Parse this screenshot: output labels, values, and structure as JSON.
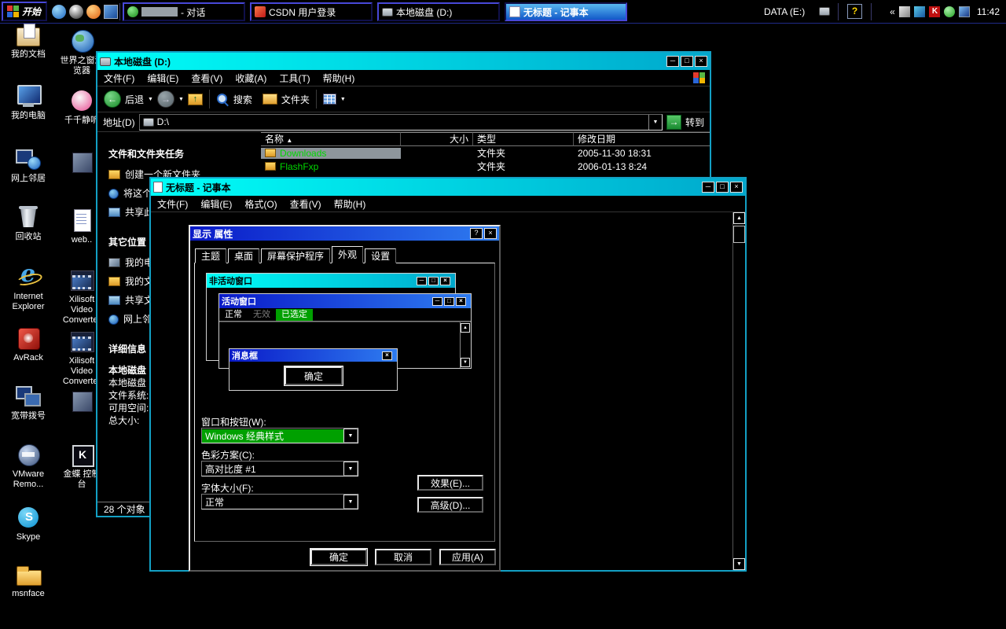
{
  "colors": {
    "active_title_start": "#0a1ac8",
    "active_title_end": "#2e7cf0",
    "inactive_title_start": "#00fff8",
    "inactive_title_end": "#00a8cc",
    "highlight_green": "#00a000",
    "filename_green": "#00d800",
    "desktop_background": "#000000"
  },
  "glyphs": {
    "minimize": "─",
    "maximize": "□",
    "close": "×",
    "help": "?",
    "dropdown": "▼",
    "up": "▲",
    "down": "▼",
    "back": "←",
    "forward": "→",
    "go": "→",
    "up_arrow": "↑",
    "sort": "▲",
    "chevron": "«"
  },
  "taskbar": {
    "start_label": "开始",
    "chat_button_suffix": "- 对话",
    "csdn_button": "CSDN 用户登录",
    "disk_button": "本地磁盘 (D:)",
    "notepad_button": "无标题 - 记事本",
    "drive_label": "DATA (E:)",
    "clock": "11:42"
  },
  "desktop": {
    "col1": [
      {
        "label": "我的文档"
      },
      {
        "label": "我的电脑"
      },
      {
        "label": "网上邻居"
      },
      {
        "label": "回收站"
      },
      {
        "label": "Internet Explorer"
      },
      {
        "label": "AvRack"
      },
      {
        "label": "宽带拨号"
      },
      {
        "label": "VMware Remo..."
      },
      {
        "label": "Skype"
      },
      {
        "label": "msnface"
      }
    ],
    "col2": [
      {
        "label": "世界之窗浏览器"
      },
      {
        "label": "千千静听"
      },
      {
        "label": ""
      },
      {
        "label": "web.."
      },
      {
        "label": "Xilisoft Video Converter"
      },
      {
        "label": "Xilisoft Video Converter"
      },
      {
        "label": ""
      },
      {
        "label": "金蝶 控制台"
      }
    ]
  },
  "explorer": {
    "title": "本地磁盘 (D:)",
    "menu": [
      "文件(F)",
      "编辑(E)",
      "查看(V)",
      "收藏(A)",
      "工具(T)",
      "帮助(H)"
    ],
    "toolbar": {
      "back": "后退",
      "search": "搜索",
      "folders": "文件夹"
    },
    "address_label": "地址(D)",
    "address_value": "D:\\",
    "go_label": "转到",
    "columns": {
      "name": "名称",
      "size": "大小",
      "type": "类型",
      "modified": "修改日期"
    },
    "rows": [
      {
        "name": "Downloads",
        "size": "",
        "type": "文件夹",
        "modified": "2005-11-30 18:31",
        "selected": true
      },
      {
        "name": "FlashFxp",
        "size": "",
        "type": "文件夹",
        "modified": "2006-01-13 8:24",
        "selected": false
      }
    ],
    "tasks_header": "文件和文件夹任务",
    "tasks": [
      "创建一个新文件夹",
      "将这个文件夹发布到 Web",
      "共享此文件夹"
    ],
    "other_header": "其它位置",
    "other_items": [
      "我的电脑",
      "我的文档",
      "共享文档",
      "网上邻居"
    ],
    "details_header": "详细信息",
    "details_title": "本地磁盘 (D:)",
    "details_lines": [
      "本地磁盘",
      "文件系统:",
      "可用空间:",
      "总大小:"
    ],
    "status": "28 个对象"
  },
  "notepad": {
    "title": "无标题 - 记事本",
    "menu": [
      "文件(F)",
      "编辑(E)",
      "格式(O)",
      "查看(V)",
      "帮助(H)"
    ]
  },
  "display_dialog": {
    "title": "显示 属性",
    "tabs": [
      "主题",
      "桌面",
      "屏幕保护程序",
      "外观",
      "设置"
    ],
    "active_tab": "外观",
    "preview": {
      "inactive_window_title": "非活动窗口",
      "active_window_title": "活动窗口",
      "menu_normal": "正常",
      "menu_disabled": "无效",
      "menu_selected": "已选定",
      "msgbox_title": "消息框",
      "msgbox_ok": "确定"
    },
    "window_buttons_label": "窗口和按钮(W):",
    "window_buttons_value": "Windows 经典样式",
    "color_scheme_label": "色彩方案(C):",
    "color_scheme_value": "高对比度 #1",
    "font_size_label": "字体大小(F):",
    "font_size_value": "正常",
    "effects_button": "效果(E)...",
    "advanced_button": "高级(D)...",
    "ok_button": "确定",
    "cancel_button": "取消",
    "apply_button": "应用(A)"
  }
}
